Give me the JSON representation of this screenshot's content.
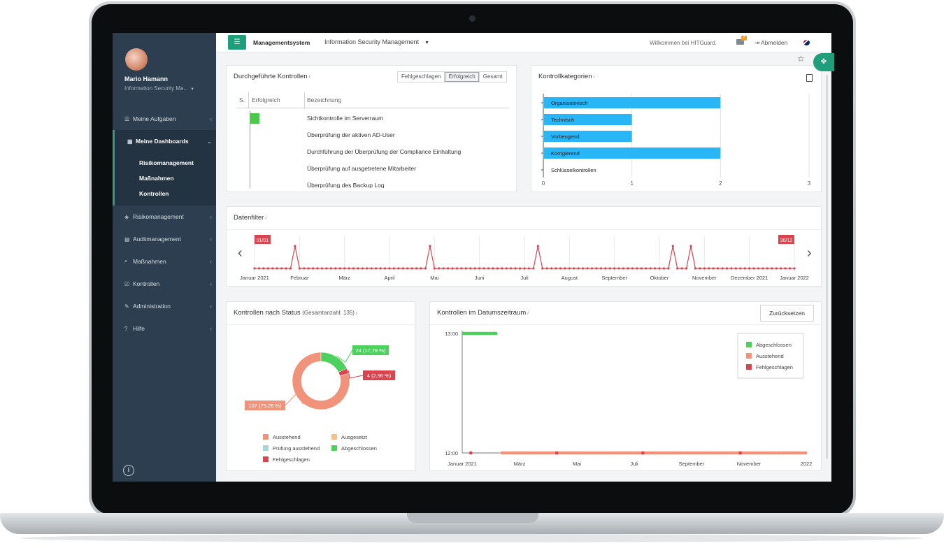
{
  "user": {
    "name": "Mario Hamann",
    "role": "Information Security Ma..."
  },
  "sidebar": {
    "items": [
      {
        "icon": "list-icon",
        "glyph": "☰",
        "label": "Meine Aufgaben"
      },
      {
        "icon": "dashboard-icon",
        "glyph": "▦",
        "label": "Meine Dashboards",
        "active": true
      },
      {
        "icon": "diamond-icon",
        "glyph": "◈",
        "label": "Risikomanagement"
      },
      {
        "icon": "clipboard-icon",
        "glyph": "▤",
        "label": "Auditmanagement"
      },
      {
        "icon": "search-icon",
        "glyph": "⌕",
        "label": "Maßnahmen"
      },
      {
        "icon": "checkbox-icon",
        "glyph": "☑",
        "label": "Kontrollen"
      },
      {
        "icon": "tools-icon",
        "glyph": "✎",
        "label": "Administration"
      },
      {
        "icon": "help-icon",
        "glyph": "?",
        "label": "Hilfe"
      }
    ],
    "dashboards_sub": [
      "Risikomanagement",
      "Maßnahmen",
      "Kontrollen"
    ]
  },
  "topbar": {
    "system": "Managementsystem",
    "module": "Information Security Management",
    "welcome": "Willkommen bei HITGuard.",
    "mail_badge": "7",
    "logout": "Abmelden"
  },
  "controls_card": {
    "title": "Durchgeführte Kontrollen",
    "info": "i",
    "tabs": [
      "Fehlgeschlagen",
      "Erfolgreich",
      "Gesamt"
    ],
    "selected_tab": "Erfolgreich",
    "columns": [
      "S.",
      "Erfolgreich",
      "Bezeichnung"
    ],
    "rows": [
      "Sichtkontrolle im Serverraum",
      "Überprüfung der aktiven AD-User",
      "Durchführung der Überprüfung der Compliance Einhaltung",
      "Überprüfung auf ausgetretene Mitarbeiter",
      "Überprüfung des Backup Log"
    ]
  },
  "categories_card": {
    "title": "Kontrollkategorien",
    "info": "i"
  },
  "datenfilter_card": {
    "title": "Datenfilter",
    "info": "i",
    "start_label": "01/01",
    "end_label": "30/12"
  },
  "status_card": {
    "title": "Kontrollen nach Status",
    "subtitle": "(Gesamtanzahl: 135)",
    "info": "i",
    "legend": [
      {
        "label": "Ausstehend",
        "color": "#f0937a"
      },
      {
        "label": "Ausgesetzt",
        "color": "#f5c08a"
      },
      {
        "label": "Prüfung ausstehend",
        "color": "#a9d4d8"
      },
      {
        "label": "Abgeschlossen",
        "color": "#4cd25c"
      },
      {
        "label": "Fehlgeschlagen",
        "color": "#d9454f"
      }
    ]
  },
  "range_card": {
    "title": "Kontrollen im Datumszeitraum",
    "info": "i",
    "reset_label": "Zurücksetzen",
    "legend": [
      {
        "label": "Abgeschlossen",
        "color": "#4cd25c"
      },
      {
        "label": "Ausstehend",
        "color": "#f0937a"
      },
      {
        "label": "Fehlgeschlagen",
        "color": "#d9454f"
      }
    ]
  },
  "chart_data": [
    {
      "type": "bar",
      "orientation": "horizontal",
      "categories": [
        "Organisatorisch",
        "Technisch",
        "Vorbeugend",
        "Korrigierend",
        "Schlüsselkontrollen"
      ],
      "values": [
        2,
        1,
        1,
        2,
        0
      ],
      "xlim": [
        0,
        3
      ],
      "xticks": [
        "0",
        "1",
        "2",
        "3"
      ],
      "color": "#29b6f6",
      "grid": true
    },
    {
      "type": "line",
      "x_labels": [
        "Januar 2021",
        "Februar",
        "März",
        "April",
        "Mai",
        "Juni",
        "Juli",
        "August",
        "September",
        "Oktober",
        "November",
        "Dezember 2021",
        "Januar 2022"
      ],
      "spike_months": [
        0.9,
        3.9,
        6.3,
        9.3,
        9.7
      ],
      "color": "#d9454f",
      "baseline": 0,
      "peak": 1
    },
    {
      "type": "pie",
      "donut": true,
      "slices": [
        {
          "label": "Ausstehend",
          "value": 107,
          "display": "107 (79,26 %)",
          "color": "#f0937a"
        },
        {
          "label": "Abgeschlossen",
          "value": 24,
          "display": "24 (17,78 %)",
          "color": "#4cd25c"
        },
        {
          "label": "Fehlgeschlagen",
          "value": 4,
          "display": "4 (2,96 %)",
          "color": "#d9454f"
        }
      ]
    },
    {
      "type": "scatter",
      "y_labels": [
        "13:00",
        "12:00"
      ],
      "x_labels": [
        "Januar 2021",
        "März",
        "Mai",
        "Juli",
        "September",
        "November",
        "2022"
      ],
      "series": [
        {
          "name": "Abgeschlossen",
          "color": "#4cd25c",
          "y": "13:00",
          "x_range_months": [
            0.05,
            1.2
          ]
        },
        {
          "name": "Ausstehend",
          "color": "#f0937a",
          "y": "12:00",
          "x_range_months": [
            1.4,
            12.0
          ]
        },
        {
          "name": "Fehlgeschlagen",
          "color": "#d9454f",
          "y": "12:00",
          "x_points_months": [
            0.3,
            3.3,
            6.3,
            9.7
          ]
        }
      ]
    }
  ]
}
